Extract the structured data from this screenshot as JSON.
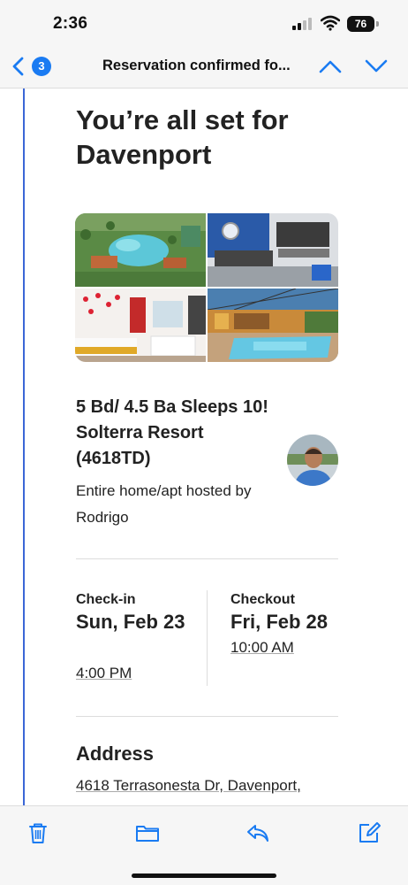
{
  "status_bar": {
    "time": "2:36",
    "battery": "76",
    "icons": [
      "signal-icon",
      "wifi-icon",
      "battery-icon"
    ]
  },
  "nav": {
    "back_icon": "chevron-left-icon",
    "unread_count": "3",
    "title": "Reservation confirmed fo...",
    "prev_icon": "chevron-up-icon",
    "next_icon": "chevron-down-icon",
    "accent_color": "#1a7bf2"
  },
  "email": {
    "headline": "You’re all set for Davenport",
    "photos": [
      "resort-aerial-photo",
      "living-room-photo",
      "kids-bedroom-photo",
      "pool-enclosure-photo"
    ],
    "listing_title": "5 Bd/ 4.5 Ba Sleeps 10! Solterra Resort (4618TD)",
    "host_line": "Entire home/apt hosted by Rodrigo",
    "checkin": {
      "label": "Check-in",
      "date": "Sun, Feb 23",
      "time": "4:00 PM"
    },
    "checkout": {
      "label": "Checkout",
      "date": "Fri, Feb 28",
      "time": "10:00 AM"
    },
    "address": {
      "label": "Address",
      "value": "4618 Terrasonesta Dr, Davenport,"
    }
  },
  "toolbar": {
    "icons": [
      "trash-icon",
      "folder-icon",
      "reply-icon",
      "compose-icon"
    ],
    "accent_color": "#1a7bf2"
  }
}
